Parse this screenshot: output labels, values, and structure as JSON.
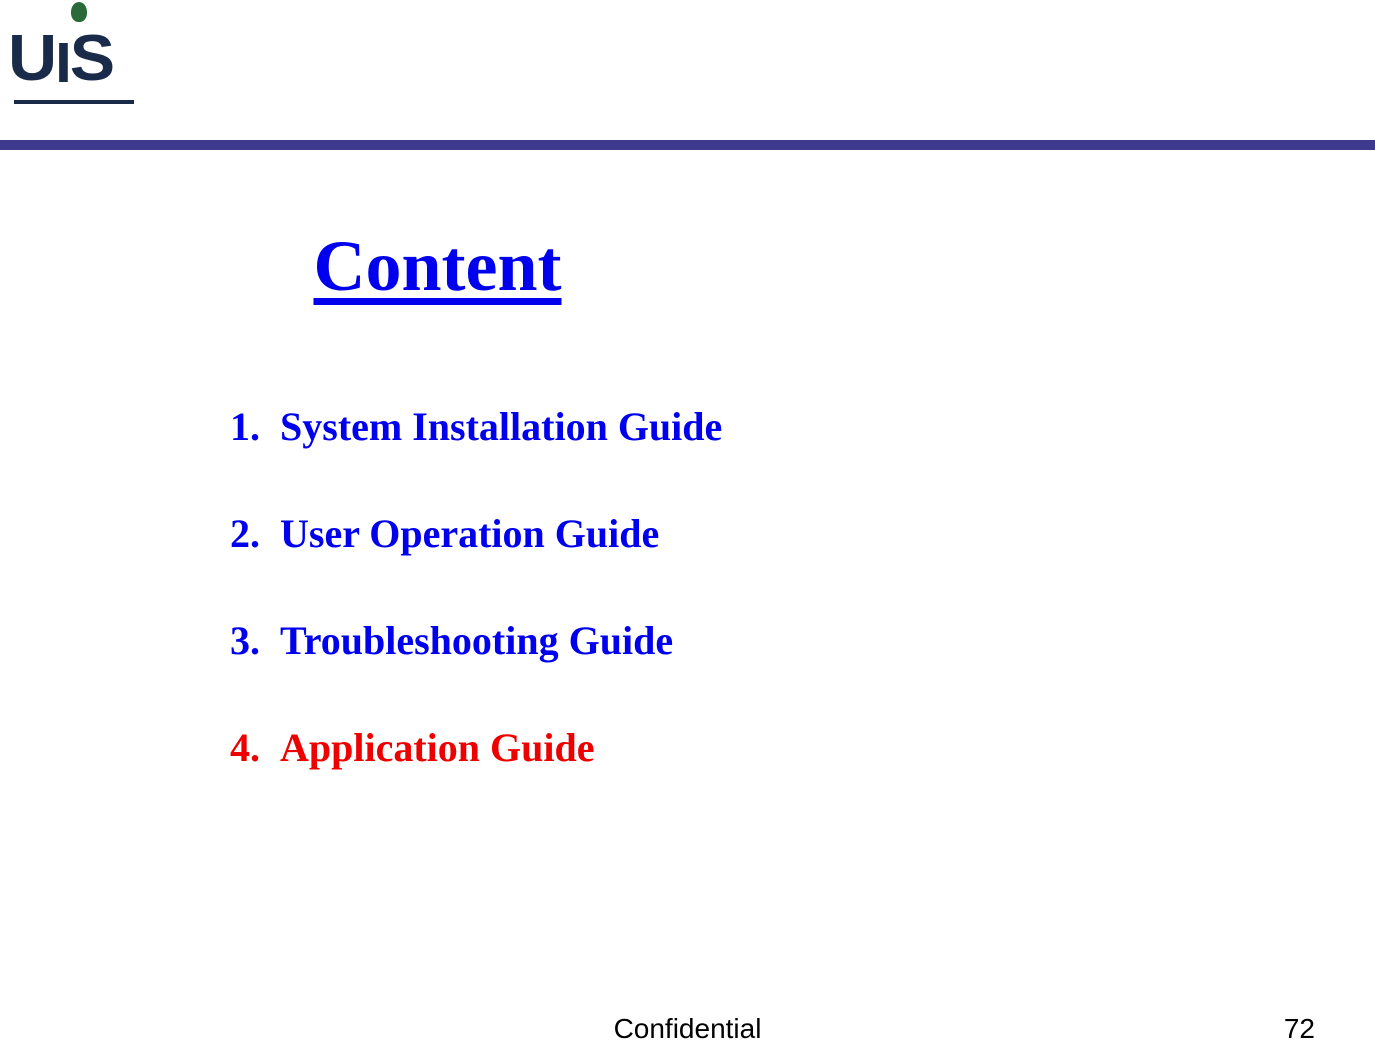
{
  "header": {
    "logo_text": "UIS"
  },
  "content": {
    "title": "Content",
    "items": [
      {
        "number": "1.",
        "label": "System Installation Guide",
        "color": "blue"
      },
      {
        "number": "2.",
        "label": "User Operation Guide",
        "color": "blue"
      },
      {
        "number": "3.",
        "label": "Troubleshooting Guide",
        "color": "blue"
      },
      {
        "number": "4.",
        "label": "Application Guide",
        "color": "red"
      }
    ]
  },
  "footer": {
    "center": "Confidential",
    "page_number": "72"
  }
}
